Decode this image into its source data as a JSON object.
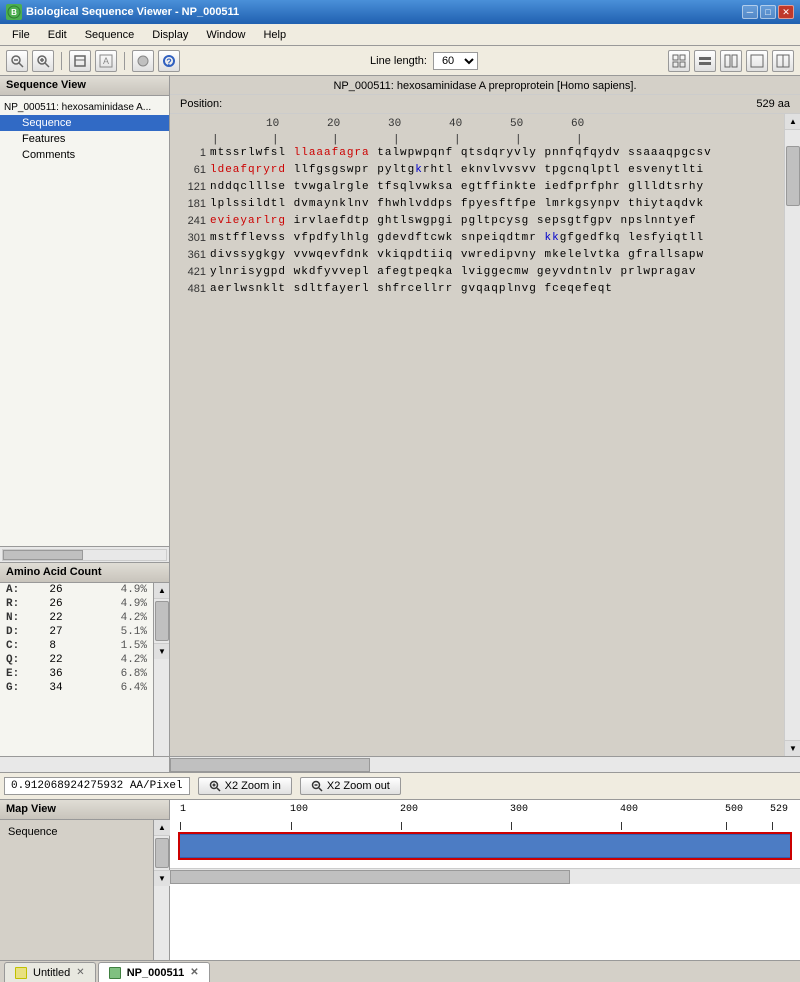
{
  "window": {
    "title": "Biological Sequence Viewer - NP_000511",
    "icon_label": "B"
  },
  "menubar": {
    "items": [
      "File",
      "Edit",
      "Sequence",
      "Display",
      "Window",
      "Help"
    ]
  },
  "toolbar": {
    "line_length_label": "Line length:",
    "line_length_value": "60"
  },
  "seq_view": {
    "header": "Sequence View",
    "tree": [
      {
        "label": "NP_000511: hexosaminidase A preproprotein [Homo sapiens].",
        "depth": 0
      },
      {
        "label": "Sequence",
        "depth": 1,
        "selected": true
      },
      {
        "label": "Features",
        "depth": 1
      },
      {
        "label": "Comments",
        "depth": 1
      }
    ]
  },
  "seq_info": {
    "title": "NP_000511: hexosaminidase A preproprotein [Homo sapiens].",
    "position_label": "Position:",
    "length": "529 aa"
  },
  "sequence_data": {
    "rows": [
      {
        "pos": 1,
        "seq": "mtssrlwfsl llaaafagra talwpwpqnf qtsdqryvly pnnfqfqydv ssaaaqpgcsv"
      },
      {
        "pos": 61,
        "seq": "ldeafqryrd llfgsgswpr pyltgkrhtl eknvlvvsvv tpgcnqlptl esvenytlti"
      },
      {
        "pos": 121,
        "seq": "nddqclllse tvwgalrgle tfsqlvwksa egtffinkte iedfprfphr gllldtsrhy"
      },
      {
        "pos": 181,
        "seq": "lplssildtl dvmaynklnv fhwhlvddps fpyesftfpe lmrkgsynpv thiytaqdvk"
      },
      {
        "pos": 241,
        "seq": "evieyarlrg irvlaefdtp ghtlswgpgi pgltpcysg sepsgtfgpv npslnntyef"
      },
      {
        "pos": 301,
        "seq": "mstfflevss vfpdfylhlg gdevdftcwk snpeiqdtmr kkgfgedfkq lesfyiqtll"
      },
      {
        "pos": 361,
        "seq": "divssygkgy vvwqevfdnk vkiqpdtiiq vwredipvny mkelelvtka gfrallsapw"
      },
      {
        "pos": 421,
        "seq": "ylnrisygpd wkdfyvvepl afegtpeqka lviggecmw geyvdntnlv prlwpragav"
      },
      {
        "pos": 481,
        "seq": "aerlwsnklt sdltfayerl shfrcellrr gvqaqplnvg fceqefeqt"
      }
    ],
    "ruler_positions": [
      10,
      20,
      30,
      40,
      50,
      60
    ]
  },
  "aa_count": {
    "header": "Amino Acid Count",
    "rows": [
      {
        "aa": "A:",
        "count": 26,
        "pct": "4.9%"
      },
      {
        "aa": "R:",
        "count": 26,
        "pct": "4.9%"
      },
      {
        "aa": "N:",
        "count": 22,
        "pct": "4.2%"
      },
      {
        "aa": "D:",
        "count": 27,
        "pct": "5.1%"
      },
      {
        "aa": "C:",
        "count": 8,
        "pct": "1.5%"
      },
      {
        "aa": "Q:",
        "count": 22,
        "pct": "4.2%"
      },
      {
        "aa": "E:",
        "count": 36,
        "pct": "6.8%"
      },
      {
        "aa": "G:",
        "count": 34,
        "pct": "6.4%"
      }
    ]
  },
  "bottom_bar": {
    "pixel_ratio": "0.912068924275932 AA/Pixel",
    "zoom_in_label": "X2 Zoom in",
    "zoom_out_label": "X2 Zoom out"
  },
  "map_view": {
    "header": "Map View",
    "list_items": [
      "Sequence"
    ],
    "ruler_marks": [
      1,
      100,
      200,
      300,
      400,
      500,
      529
    ]
  },
  "tabs": [
    {
      "label": "Untitled",
      "closable": true,
      "active": false
    },
    {
      "label": "NP_000511",
      "closable": true,
      "active": true
    }
  ]
}
